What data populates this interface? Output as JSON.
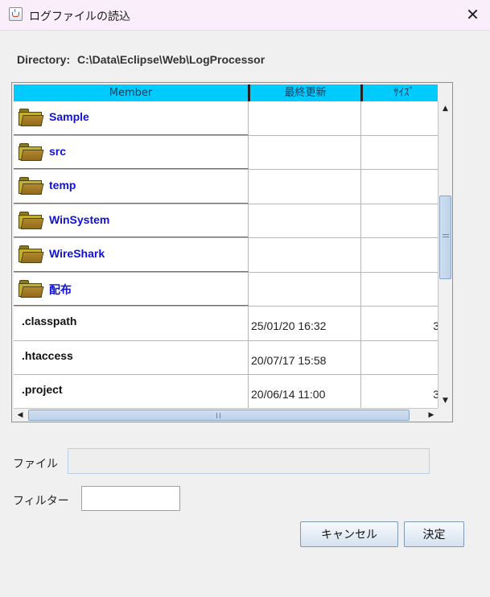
{
  "window": {
    "title": "ログファイルの読込",
    "close_label": "✕",
    "icon": "java-cup-icon"
  },
  "directory": {
    "label": "Directory:",
    "path": "C:\\Data\\Eclipse\\Web\\LogProcessor"
  },
  "table": {
    "columns": [
      "Member",
      "最終更新",
      "ｻｲｽﾞ"
    ],
    "rows": [
      {
        "type": "folder",
        "name": "Sample",
        "date": "",
        "size": ""
      },
      {
        "type": "folder",
        "name": "src",
        "date": "",
        "size": ""
      },
      {
        "type": "folder",
        "name": "temp",
        "date": "",
        "size": ""
      },
      {
        "type": "folder",
        "name": "WinSystem",
        "date": "",
        "size": ""
      },
      {
        "type": "folder",
        "name": "WireShark",
        "date": "",
        "size": ""
      },
      {
        "type": "folder",
        "name": "配布",
        "date": "",
        "size": ""
      },
      {
        "type": "file",
        "name": ".classpath",
        "date": "25/01/20 16:32",
        "size": "3"
      },
      {
        "type": "file",
        "name": ".htaccess",
        "date": "20/07/17 15:58",
        "size": ""
      },
      {
        "type": "file",
        "name": ".project",
        "date": "20/06/14 11:00",
        "size": "3"
      }
    ]
  },
  "scrollbar": {
    "up": "▲",
    "down": "▼",
    "left": "◀",
    "right": "▶"
  },
  "form": {
    "file_label": "ファイル",
    "file_value": "",
    "filter_label": "フィルター",
    "filter_value": ""
  },
  "buttons": {
    "cancel": "キャンセル",
    "ok": "決定"
  },
  "colors": {
    "header_bg": "#00cbff",
    "folder_text": "#1010d8",
    "title_bar": "#f9eef9"
  }
}
